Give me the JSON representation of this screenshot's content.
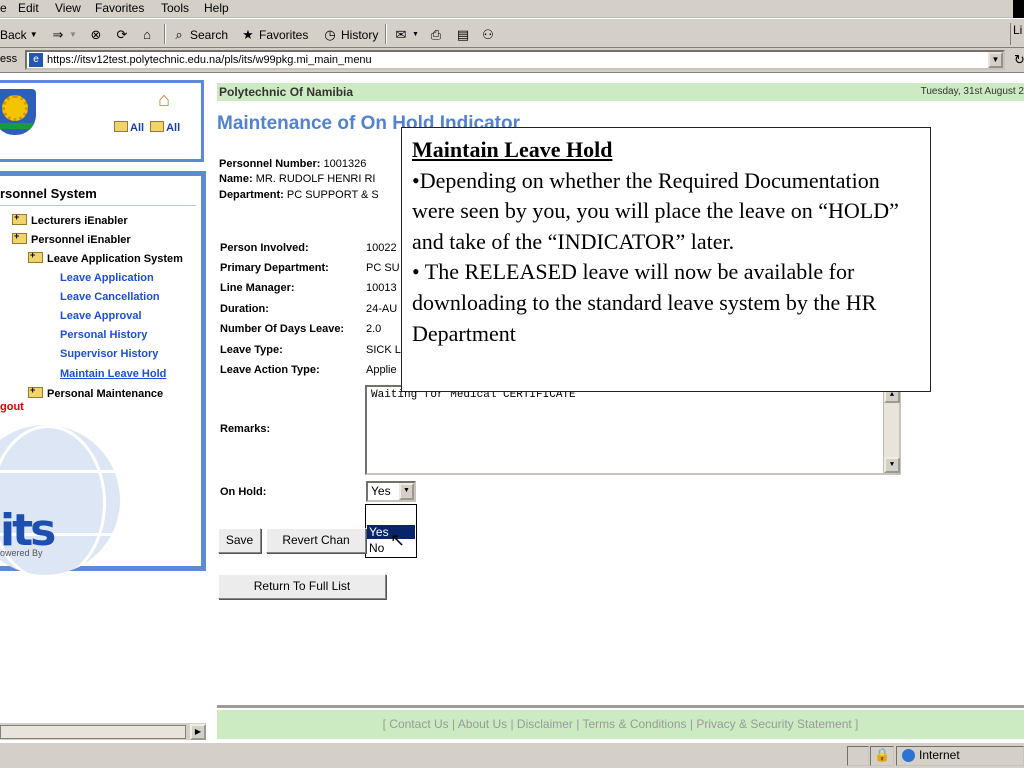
{
  "browser": {
    "menu": [
      "e",
      "Edit",
      "View",
      "Favorites",
      "Tools",
      "Help"
    ],
    "toolbar": {
      "back": "Back",
      "search": "Search",
      "favorites": "Favorites",
      "history": "History",
      "right_edge": "Li"
    },
    "address": {
      "label": "ess",
      "url": "https://itsv12test.polytechnic.edu.na/pls/its/w99pkg.mi_main_menu"
    },
    "status": {
      "zone": "Internet"
    }
  },
  "sidebar": {
    "all_links": [
      "All",
      "All"
    ],
    "menu_title": "rsonnel System",
    "items": [
      {
        "label": "Lecturers iEnabler",
        "kind": "folder"
      },
      {
        "label": "Personnel iEnabler",
        "kind": "folder"
      },
      {
        "label": "Leave Application System",
        "kind": "folder"
      },
      {
        "label": "Leave Application",
        "kind": "link"
      },
      {
        "label": "Leave Cancellation",
        "kind": "link"
      },
      {
        "label": "Leave Approval",
        "kind": "link"
      },
      {
        "label": "Personal History",
        "kind": "link"
      },
      {
        "label": "Supervisor History",
        "kind": "link"
      },
      {
        "label": "Maintain Leave Hold",
        "kind": "link-current"
      },
      {
        "label": "Personal Maintenance",
        "kind": "folder"
      }
    ],
    "logout": "gout",
    "logo_text": "its",
    "powered_by": "owered By"
  },
  "main": {
    "org": "Polytechnic Of Namibia",
    "date": "Tuesday, 31st August 2",
    "title": "Maintenance of On Hold Indicator",
    "personnel": {
      "number_label": "Personnel Number:",
      "number_value": "1001326",
      "name_label": "Name:",
      "name_value": "MR. RUDOLF HENRI RI",
      "dept_label": "Department:",
      "dept_value": "PC SUPPORT & S"
    },
    "fields": [
      {
        "label": "Person Involved:",
        "value": "10022"
      },
      {
        "label": "Primary Department:",
        "value": "PC SU"
      },
      {
        "label": "Line Manager:",
        "value": "10013"
      },
      {
        "label": "Duration:",
        "value": "24-AU"
      },
      {
        "label": "Number Of Days Leave:",
        "value": "2.0"
      },
      {
        "label": "Leave Type:",
        "value": "SICK L"
      },
      {
        "label": "Leave Action Type:",
        "value": "Applie"
      }
    ],
    "remarks_label": "Remarks:",
    "remarks_value": "Waiting for Medical CERTIFICATE",
    "on_hold_label": "On Hold:",
    "on_hold_value": "Yes",
    "on_hold_options": [
      "Yes",
      "No"
    ],
    "save_button": "Save",
    "revert_button": "Revert Chan",
    "return_button": "Return To Full List",
    "footer": "[ Contact Us | About Us | Disclaimer | Terms & Conditions | Privacy & Security Statement ]"
  },
  "callout": {
    "title": "Maintain Leave Hold",
    "bullet1": "•Depending on whether the Required Documentation were seen by you, you will place the leave on “HOLD” and take of the “INDICATOR” later.",
    "bullet2": "• The RELEASED leave will now be available for downloading to the standard leave system by the HR Department"
  }
}
